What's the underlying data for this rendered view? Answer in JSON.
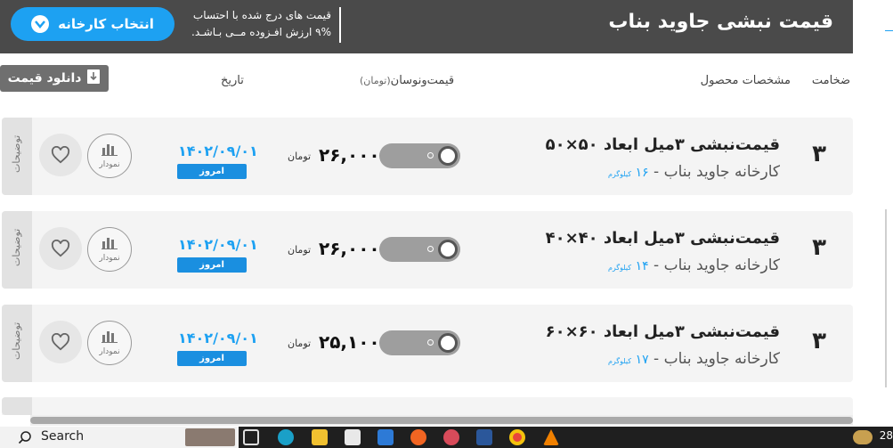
{
  "header": {
    "title": "قیمت نبشی جاوید بناب",
    "note_line1": "قیمت های درج شده با احتساب",
    "note_line2": "۹% ارزش افـزوده مــی بـاشـد.",
    "select_factory_label": "انتخاب کارخانه"
  },
  "toolbar": {
    "download_label": "دانلود قیمت"
  },
  "columns": {
    "thickness": "ضخامت",
    "specs": "مشخصات محصول",
    "price": "قیمت‌ونوسان",
    "price_unit": "(تومان)",
    "date": "تاریخ"
  },
  "rows": [
    {
      "thickness": "۳",
      "name": "قیمت‌نبشی ۳میل ابعاد ۵۰×۵۰",
      "maker": "کارخانه جاوید بناب -",
      "weight": "۱۶",
      "weight_unit": "کیلوگرم",
      "price": "۲۶,۰۰۰",
      "unit": "تومان",
      "date": "۱۴۰۲/۰۹/۰۱",
      "today": "امروز",
      "chart_label": "نمودار",
      "desc_label": "توضیحات"
    },
    {
      "thickness": "۳",
      "name": "قیمت‌نبشی ۳میل ابعاد ۴۰×۴۰",
      "maker": "کارخانه جاوید بناب -",
      "weight": "۱۴",
      "weight_unit": "کیلوگرم",
      "price": "۲۶,۰۰۰",
      "unit": "تومان",
      "date": "۱۴۰۲/۰۹/۰۱",
      "today": "امروز",
      "chart_label": "نمودار",
      "desc_label": "توضیحات"
    },
    {
      "thickness": "۳",
      "name": "قیمت‌نبشی ۳میل ابعاد ۶۰×۶۰",
      "maker": "کارخانه جاوید بناب -",
      "weight": "۱۷",
      "weight_unit": "کیلوگرم",
      "price": "۲۵,۱۰۰",
      "unit": "تومان",
      "date": "۱۴۰۲/۰۹/۰۱",
      "today": "امروز",
      "chart_label": "نمودار",
      "desc_label": "توضیحات"
    }
  ],
  "taskbar": {
    "search_label": "Search",
    "tray_text": "28"
  },
  "colors": {
    "header_bg": "#4a4a4a",
    "accent_blue": "#1da1f2",
    "today_badge": "#1a8fe0",
    "row_bg": "#f4f4f4"
  },
  "icons": [
    "chevron-down-icon",
    "download-icon",
    "heart-icon",
    "bar-chart-icon",
    "toggle-switch",
    "search-icon"
  ]
}
